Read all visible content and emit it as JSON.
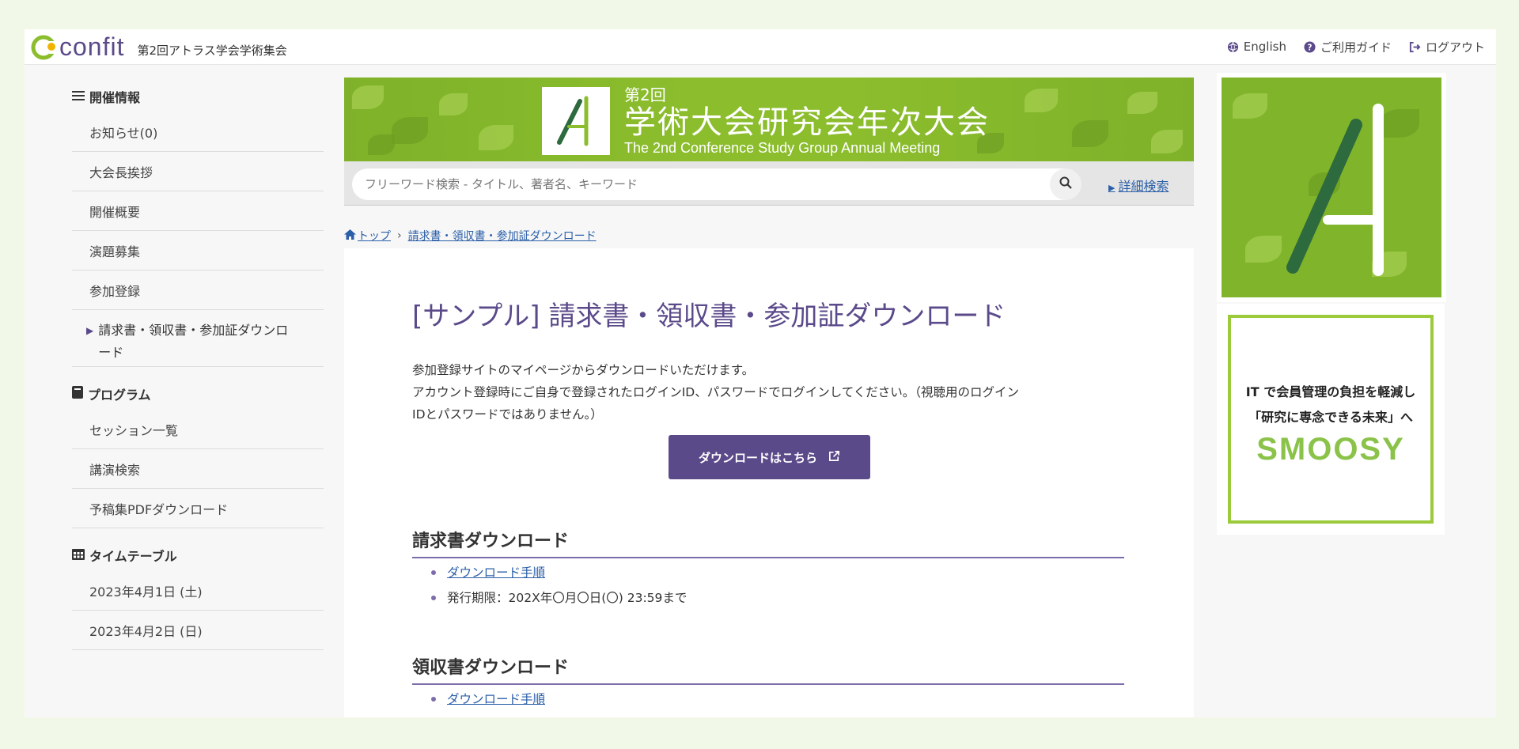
{
  "header": {
    "logo_text": "confit",
    "site_name": "第2回アトラス学会学術集会",
    "links": [
      {
        "label": "English",
        "icon": "globe-icon"
      },
      {
        "label": "ご利用ガイド",
        "icon": "question-circle-icon"
      },
      {
        "label": "ログアウト",
        "icon": "logout-icon"
      }
    ]
  },
  "sidebar": {
    "sections": [
      {
        "title": "開催情報",
        "icon": "list-icon",
        "items": [
          "お知らせ(0)",
          "大会長挨拶",
          "開催概要",
          "演題募集",
          "参加登録"
        ],
        "active_item": "請求書・領収書・参加証ダウンロード"
      },
      {
        "title": "プログラム",
        "icon": "book-icon",
        "items": [
          "セッション一覧",
          "講演検索",
          "予稿集PDFダウンロード"
        ]
      },
      {
        "title": "タイムテーブル",
        "icon": "calendar-icon",
        "items": [
          "2023年4月1日 (土)",
          "2023年4月2日 (日)"
        ]
      }
    ]
  },
  "banner": {
    "small": "第2回",
    "title": "学術大会研究会年次大会",
    "english": "The 2nd Conference Study Group Annual Meeting"
  },
  "search": {
    "placeholder": "フリーワード検索 - タイトル、著者名、キーワード",
    "advanced_label": "詳細検索"
  },
  "breadcrumb": {
    "home": "トップ",
    "current": "請求書・領収書・参加証ダウンロード"
  },
  "main": {
    "title": "[サンプル] 請求書・領収書・参加証ダウンロード",
    "intro_line1": "参加登録サイトのマイページからダウンロードいただけます。",
    "intro_line2": "アカウント登録時にご自身で登録されたログインID、パスワードでログインしてください。（視聴用のログイン",
    "intro_line3": "IDとパスワードではありません。）",
    "download_button": "ダウンロードはこちら",
    "sections": [
      {
        "heading": "請求書ダウンロード",
        "link": "ダウンロード手順",
        "note": "発行期限：202X年〇月〇日(〇) 23:59まで"
      },
      {
        "heading": "領収書ダウンロード",
        "link": "ダウンロード手順"
      }
    ]
  },
  "ads": {
    "smoosy_line1": "IT で会員管理の負担を軽減し",
    "smoosy_line2": "「研究に専念できる未来」へ",
    "smoosy_brand": "SMOOSY"
  },
  "colors": {
    "accent": "#5b4a8a",
    "banner_green": "#8bbd2d",
    "link": "#2b5fa8"
  }
}
